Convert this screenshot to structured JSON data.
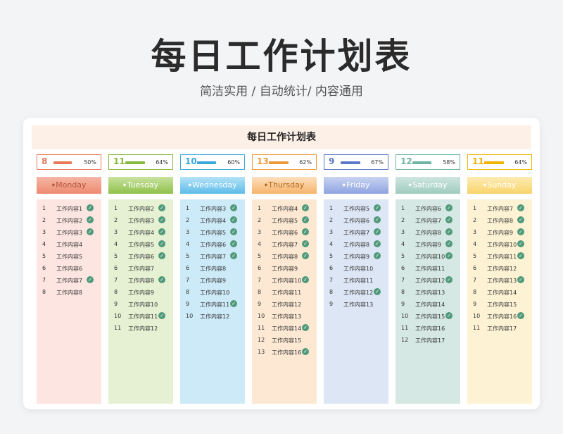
{
  "header": {
    "title": "每日工作计划表",
    "subtitle": "简洁实用 / 自动统计/ 内容通用"
  },
  "sheet": {
    "title": "每日工作计划表"
  },
  "days": [
    {
      "name": "Monday",
      "count": "8",
      "percent": "50%",
      "progress": 0.5,
      "color": "#e8785a",
      "headerBg": "linear-gradient(#f5b7a5,#ee8a70)",
      "headerText": "#b5553b",
      "listBg": "#fde5e1",
      "tasks": [
        {
          "n": "1",
          "t": "工作内容1",
          "done": true
        },
        {
          "n": "2",
          "t": "工作内容2",
          "done": true
        },
        {
          "n": "3",
          "t": "工作内容3",
          "done": true
        },
        {
          "n": "4",
          "t": "工作内容4",
          "done": false
        },
        {
          "n": "5",
          "t": "工作内容5",
          "done": false
        },
        {
          "n": "6",
          "t": "工作内容6",
          "done": false
        },
        {
          "n": "7",
          "t": "工作内容7",
          "done": true
        },
        {
          "n": "8",
          "t": "工作内容8",
          "done": false
        }
      ]
    },
    {
      "name": "Tuesday",
      "count": "11",
      "percent": "64%",
      "progress": 0.64,
      "color": "#86b83c",
      "headerBg": "linear-gradient(#c9e3a0,#8fc04a)",
      "headerText": "#ffffff",
      "listBg": "#e6f0d3",
      "tasks": [
        {
          "n": "1",
          "t": "工作内容2",
          "done": true
        },
        {
          "n": "2",
          "t": "工作内容3",
          "done": true
        },
        {
          "n": "3",
          "t": "工作内容4",
          "done": true
        },
        {
          "n": "4",
          "t": "工作内容5",
          "done": true
        },
        {
          "n": "5",
          "t": "工作内容6",
          "done": true
        },
        {
          "n": "6",
          "t": "工作内容7",
          "done": false
        },
        {
          "n": "7",
          "t": "工作内容8",
          "done": true
        },
        {
          "n": "8",
          "t": "工作内容9",
          "done": false
        },
        {
          "n": "9",
          "t": "工作内容10",
          "done": false
        },
        {
          "n": "10",
          "t": "工作内容11",
          "done": true
        },
        {
          "n": "11",
          "t": "工作内容12",
          "done": false
        }
      ]
    },
    {
      "name": "Wednesday",
      "count": "10",
      "percent": "60%",
      "progress": 0.6,
      "color": "#3aa7db",
      "headerBg": "linear-gradient(#b4e2f7,#5dbce9)",
      "headerText": "#ffffff",
      "listBg": "#cdeaf8",
      "tasks": [
        {
          "n": "1",
          "t": "工作内容3",
          "done": true
        },
        {
          "n": "2",
          "t": "工作内容4",
          "done": true
        },
        {
          "n": "3",
          "t": "工作内容5",
          "done": true
        },
        {
          "n": "4",
          "t": "工作内容6",
          "done": true
        },
        {
          "n": "5",
          "t": "工作内容7",
          "done": true
        },
        {
          "n": "6",
          "t": "工作内容8",
          "done": false
        },
        {
          "n": "7",
          "t": "工作内容9",
          "done": false
        },
        {
          "n": "8",
          "t": "工作内容10",
          "done": false
        },
        {
          "n": "9",
          "t": "工作内容11",
          "done": true
        },
        {
          "n": "10",
          "t": "工作内容12",
          "done": false
        }
      ]
    },
    {
      "name": "Thursday",
      "count": "13",
      "percent": "62%",
      "progress": 0.62,
      "color": "#ef9a3a",
      "headerBg": "linear-gradient(#fde0bf,#f6b46b)",
      "headerText": "#b26a22",
      "listBg": "#fde9d3",
      "tasks": [
        {
          "n": "1",
          "t": "工作内容4",
          "done": true
        },
        {
          "n": "2",
          "t": "工作内容5",
          "done": true
        },
        {
          "n": "3",
          "t": "工作内容6",
          "done": true
        },
        {
          "n": "4",
          "t": "工作内容7",
          "done": true
        },
        {
          "n": "5",
          "t": "工作内容8",
          "done": true
        },
        {
          "n": "6",
          "t": "工作内容9",
          "done": false
        },
        {
          "n": "7",
          "t": "工作内容10",
          "done": true
        },
        {
          "n": "8",
          "t": "工作内容11",
          "done": false
        },
        {
          "n": "9",
          "t": "工作内容12",
          "done": false
        },
        {
          "n": "10",
          "t": "工作内容13",
          "done": false
        },
        {
          "n": "11",
          "t": "工作内容14",
          "done": true
        },
        {
          "n": "12",
          "t": "工作内容15",
          "done": false
        },
        {
          "n": "13",
          "t": "工作内容16",
          "done": true
        }
      ]
    },
    {
      "name": "Friday",
      "count": "9",
      "percent": "67%",
      "progress": 0.67,
      "color": "#5a78c8",
      "headerBg": "linear-gradient(#c9d4f2,#8ea3e0)",
      "headerText": "#ffffff",
      "listBg": "#dde6f5",
      "tasks": [
        {
          "n": "1",
          "t": "工作内容5",
          "done": true
        },
        {
          "n": "2",
          "t": "工作内容6",
          "done": true
        },
        {
          "n": "3",
          "t": "工作内容7",
          "done": true
        },
        {
          "n": "4",
          "t": "工作内容8",
          "done": true
        },
        {
          "n": "5",
          "t": "工作内容9",
          "done": true
        },
        {
          "n": "6",
          "t": "工作内容10",
          "done": false
        },
        {
          "n": "7",
          "t": "工作内容11",
          "done": false
        },
        {
          "n": "8",
          "t": "工作内容12",
          "done": true
        },
        {
          "n": "9",
          "t": "工作内容13",
          "done": false
        }
      ]
    },
    {
      "name": "Saturday",
      "count": "12",
      "percent": "58%",
      "progress": 0.58,
      "color": "#6fb4a4",
      "headerBg": "linear-gradient(#cfe6df,#9fcbbf)",
      "headerText": "#ffffff",
      "listBg": "#d6e8e3",
      "tasks": [
        {
          "n": "1",
          "t": "工作内容6",
          "done": true
        },
        {
          "n": "2",
          "t": "工作内容7",
          "done": true
        },
        {
          "n": "3",
          "t": "工作内容8",
          "done": true
        },
        {
          "n": "4",
          "t": "工作内容9",
          "done": true
        },
        {
          "n": "5",
          "t": "工作内容10",
          "done": true
        },
        {
          "n": "6",
          "t": "工作内容11",
          "done": false
        },
        {
          "n": "7",
          "t": "工作内容12",
          "done": true
        },
        {
          "n": "8",
          "t": "工作内容13",
          "done": false
        },
        {
          "n": "9",
          "t": "工作内容14",
          "done": false
        },
        {
          "n": "10",
          "t": "工作内容15",
          "done": true
        },
        {
          "n": "11",
          "t": "工作内容16",
          "done": false
        },
        {
          "n": "12",
          "t": "工作内容17",
          "done": false
        }
      ]
    },
    {
      "name": "Sunday",
      "count": "11",
      "percent": "64%",
      "progress": 0.64,
      "color": "#f0b400",
      "headerBg": "linear-gradient(#fdebb4,#f8d46a)",
      "headerText": "#ffffff",
      "listBg": "#fdf3d4",
      "tasks": [
        {
          "n": "1",
          "t": "工作内容7",
          "done": true
        },
        {
          "n": "2",
          "t": "工作内容8",
          "done": true
        },
        {
          "n": "3",
          "t": "工作内容9",
          "done": true
        },
        {
          "n": "4",
          "t": "工作内容10",
          "done": true
        },
        {
          "n": "5",
          "t": "工作内容11",
          "done": true
        },
        {
          "n": "6",
          "t": "工作内容12",
          "done": false
        },
        {
          "n": "7",
          "t": "工作内容13",
          "done": true
        },
        {
          "n": "8",
          "t": "工作内容14",
          "done": false
        },
        {
          "n": "9",
          "t": "工作内容15",
          "done": false
        },
        {
          "n": "10",
          "t": "工作内容16",
          "done": true
        },
        {
          "n": "11",
          "t": "工作内容17",
          "done": false
        }
      ]
    }
  ]
}
